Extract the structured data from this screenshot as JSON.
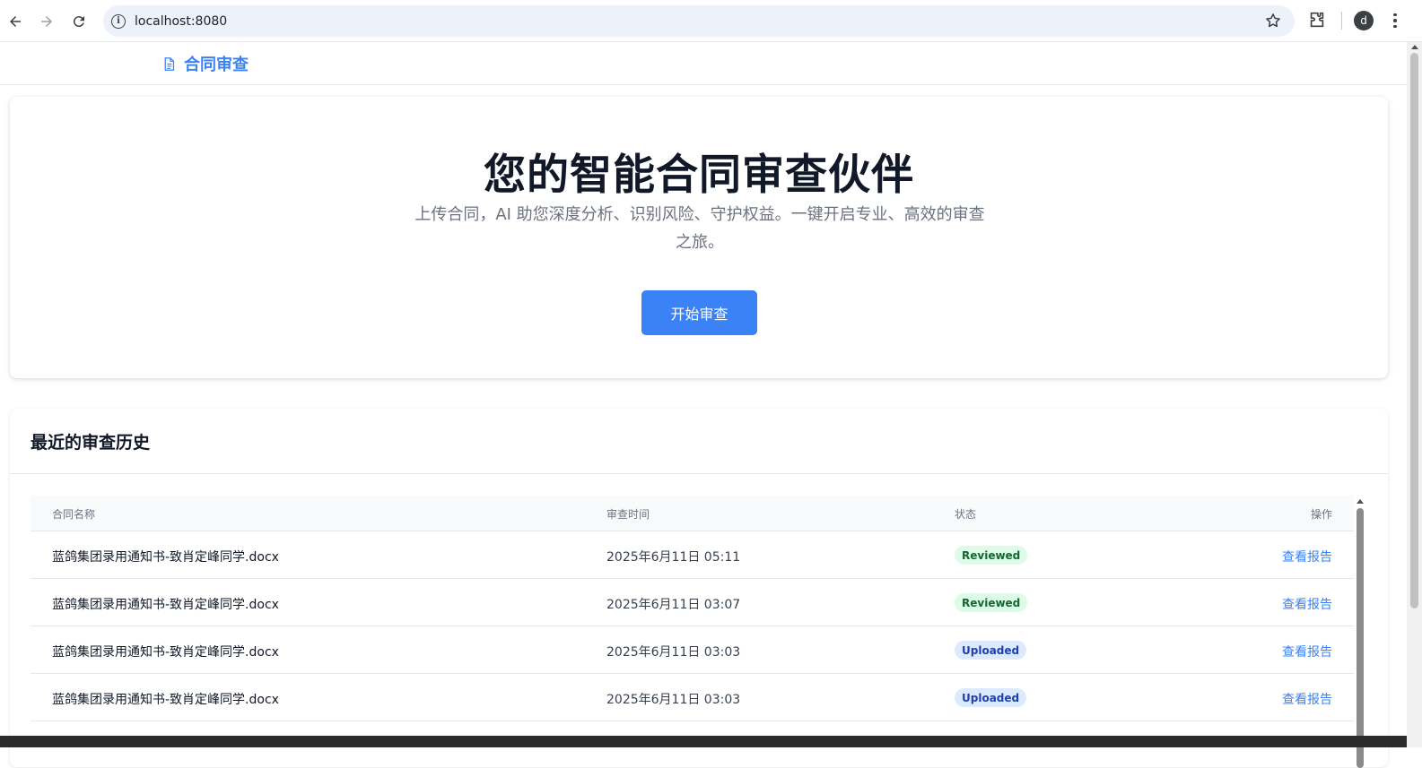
{
  "browser": {
    "url": "localhost:8080",
    "profile_initial": "d",
    "icons": [
      "back-arrow-icon",
      "forward-arrow-icon",
      "reload-icon",
      "site-info-icon",
      "bookmark-star-icon",
      "extensions-icon",
      "more-menu-icon"
    ]
  },
  "header": {
    "brand": "合同审查",
    "brand_icon": "document-icon",
    "accent_color": "#3b82f6"
  },
  "hero": {
    "title": "您的智能合同审查伙伴",
    "subtitle": "上传合同，AI 助您深度分析、识别风险、守护权益。一键开启专业、高效的审查之旅。",
    "cta_label": "开始审查"
  },
  "history": {
    "title": "最近的审查历史",
    "columns": [
      "合同名称",
      "审查时间",
      "状态",
      "操作"
    ],
    "rows": [
      {
        "name": "蓝鸽集团录用通知书-致肖定峰同学.docx",
        "time": "2025年6月11日 05:11",
        "status": "Reviewed",
        "action": "查看报告"
      },
      {
        "name": "蓝鸽集团录用通知书-致肖定峰同学.docx",
        "time": "2025年6月11日 03:07",
        "status": "Reviewed",
        "action": "查看报告"
      },
      {
        "name": "蓝鸽集团录用通知书-致肖定峰同学.docx",
        "time": "2025年6月11日 03:03",
        "status": "Uploaded",
        "action": "查看报告"
      },
      {
        "name": "蓝鸽集团录用通知书-致肖定峰同学.docx",
        "time": "2025年6月11日 03:03",
        "status": "Uploaded",
        "action": "查看报告"
      }
    ],
    "status_colors": {
      "Reviewed": "#166534",
      "Uploaded": "#1e40af"
    }
  }
}
